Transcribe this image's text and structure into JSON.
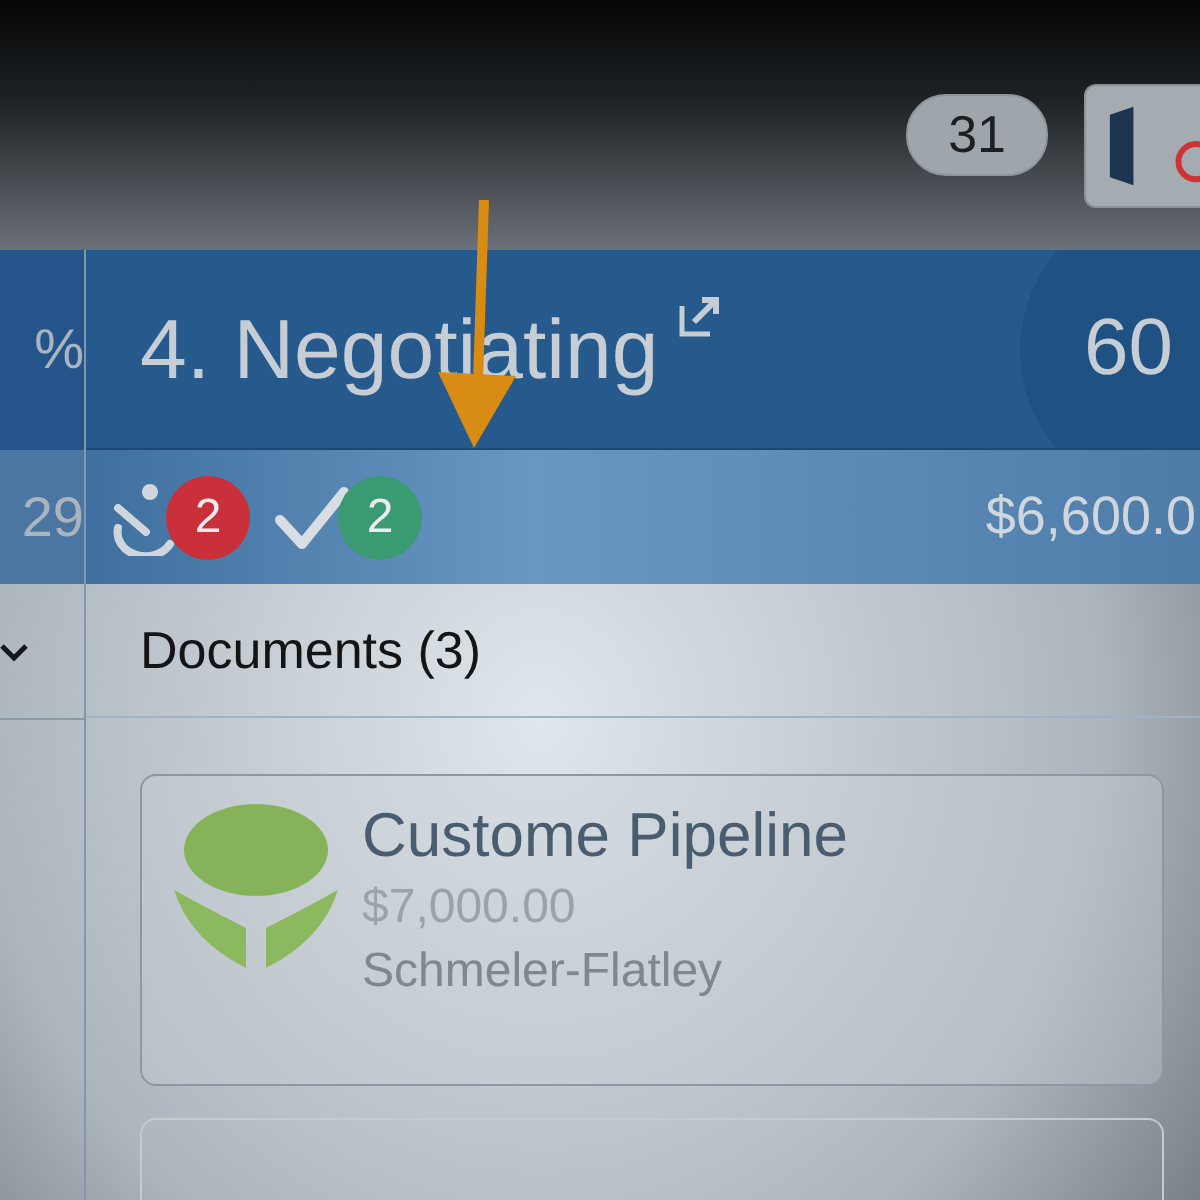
{
  "top_bar": {
    "count": "31"
  },
  "left_column": {
    "header_value": "%",
    "sub_value": "29"
  },
  "stage": {
    "title": "4. Negotiating",
    "progress": "60",
    "amount": "$6,600.0",
    "badges": [
      {
        "kind": "activity",
        "count": "2",
        "color": "#c9303a"
      },
      {
        "kind": "done",
        "count": "2",
        "color": "#3a9a72"
      }
    ]
  },
  "section": {
    "title": "Documents (3)"
  },
  "cards": [
    {
      "title": "Custome Pipeline",
      "amount": "$7,000.00",
      "company": "Schmeler-Flatley"
    }
  ]
}
